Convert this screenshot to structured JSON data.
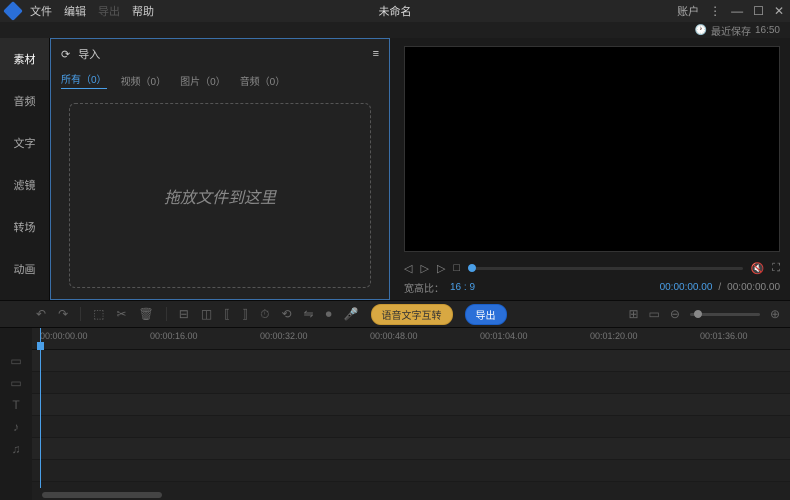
{
  "titlebar": {
    "menu": {
      "file": "文件",
      "edit": "编辑",
      "export": "导出",
      "help": "帮助"
    },
    "title": "未命名",
    "account": "账户"
  },
  "save_status": {
    "label": "最近保存",
    "time": "16:50"
  },
  "sidebar": {
    "items": [
      {
        "label": "素材"
      },
      {
        "label": "音频"
      },
      {
        "label": "文字"
      },
      {
        "label": "滤镜"
      },
      {
        "label": "转场"
      },
      {
        "label": "动画"
      }
    ]
  },
  "media_panel": {
    "import_label": "导入",
    "tabs": {
      "all": "所有（0）",
      "video": "视频（0）",
      "image": "图片（0）",
      "audio": "音频（0）"
    },
    "drop_hint": "拖放文件到这里"
  },
  "preview": {
    "ratio_label": "宽高比：",
    "ratio_value": "16 : 9",
    "time_current": "00:00:00.00",
    "time_sep": "/",
    "time_total": "00:00:00.00"
  },
  "toolbar": {
    "btn_speech": "语音文字互转",
    "btn_export": "导出"
  },
  "timeline": {
    "ticks": [
      "00:00:00.00",
      "00:00:16.00",
      "00:00:32.00",
      "00:00:48.00",
      "00:01:04.00",
      "00:01:20.00",
      "00:01:36.00"
    ]
  }
}
